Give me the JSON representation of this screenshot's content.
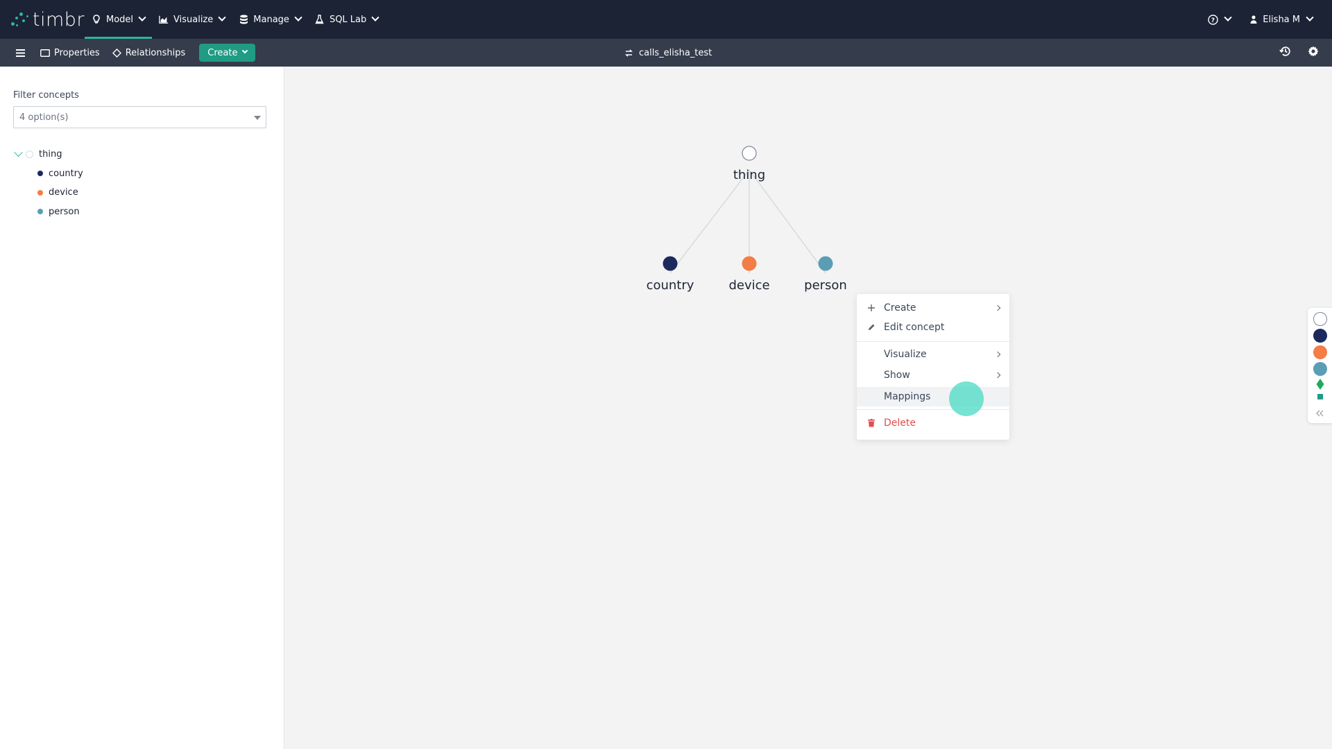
{
  "nav": {
    "logo_text": "timbr",
    "items": [
      {
        "label": "Model",
        "icon": "lightbulb-icon",
        "active": true
      },
      {
        "label": "Visualize",
        "icon": "area-chart-icon",
        "active": false
      },
      {
        "label": "Manage",
        "icon": "database-icon",
        "active": false
      },
      {
        "label": "SQL Lab",
        "icon": "flask-icon",
        "active": false
      }
    ],
    "help_icon": "help-circle-icon",
    "user": "Elisha M"
  },
  "toolbar": {
    "properties_label": "Properties",
    "relationships_label": "Relationships",
    "create_label": "Create",
    "ontology_name": "calls_elisha_test"
  },
  "sidebar": {
    "filter_label": "Filter concepts",
    "filter_value": "4 option(s)",
    "tree": {
      "root": {
        "label": "thing",
        "color": "#ffffff"
      },
      "children": [
        {
          "label": "country",
          "color": "#1b2a5c"
        },
        {
          "label": "device",
          "color": "#f47c45"
        },
        {
          "label": "person",
          "color": "#5b9db5"
        }
      ]
    }
  },
  "graph": {
    "root": {
      "label": "thing",
      "color": "#ffffff"
    },
    "children": [
      {
        "label": "country",
        "color": "#1b2a5c"
      },
      {
        "label": "device",
        "color": "#f47c45"
      },
      {
        "label": "person",
        "color": "#5b9db5"
      }
    ]
  },
  "context_menu": {
    "create": "Create",
    "edit_concept": "Edit concept",
    "visualize": "Visualize",
    "show": "Show",
    "mappings": "Mappings",
    "delete": "Delete"
  },
  "palette": {
    "colors": [
      "#ffffff",
      "#1b2a5c",
      "#f47c45",
      "#5b9db5",
      "#1faa5e",
      "#1f9c83"
    ]
  }
}
